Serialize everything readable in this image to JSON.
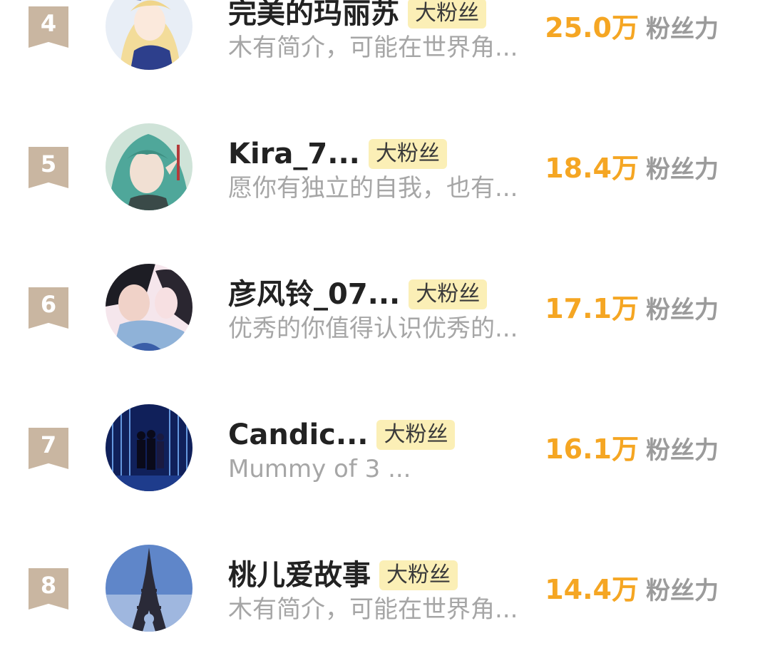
{
  "fans": [
    {
      "rank": "4",
      "name": "完美的玛丽苏",
      "badge": "大粉丝",
      "bio": "木有简介，可能在世界角...",
      "score": "25.0万",
      "score_label": "粉丝力",
      "avatar_icon": "anime-girl-blonde-avatar"
    },
    {
      "rank": "5",
      "name": "Kira_7...",
      "badge": "大粉丝",
      "bio": "愿你有独立的自我，也有...",
      "score": "18.4万",
      "score_label": "粉丝力",
      "avatar_icon": "anime-elf-teal-hair-avatar"
    },
    {
      "rank": "6",
      "name": "彦风铃_07...",
      "badge": "大粉丝",
      "bio": "优秀的你值得认识优秀的...",
      "score": "17.1万",
      "score_label": "粉丝力",
      "avatar_icon": "anime-couple-avatar"
    },
    {
      "rank": "7",
      "name": "Candic...",
      "badge": "大粉丝",
      "bio": "Mummy of 3 ...",
      "score": "16.1万",
      "score_label": "粉丝力",
      "avatar_icon": "light-tunnel-photo-avatar"
    },
    {
      "rank": "8",
      "name": "桃儿爱故事",
      "badge": "大粉丝",
      "bio": "木有简介，可能在世界角...",
      "score": "14.4万",
      "score_label": "粉丝力",
      "avatar_icon": "eiffel-tower-photo-avatar"
    }
  ],
  "colors": {
    "score": "#f5a623",
    "badge_bg": "#fbefb6",
    "rank_bg": "#c9b6a1"
  }
}
